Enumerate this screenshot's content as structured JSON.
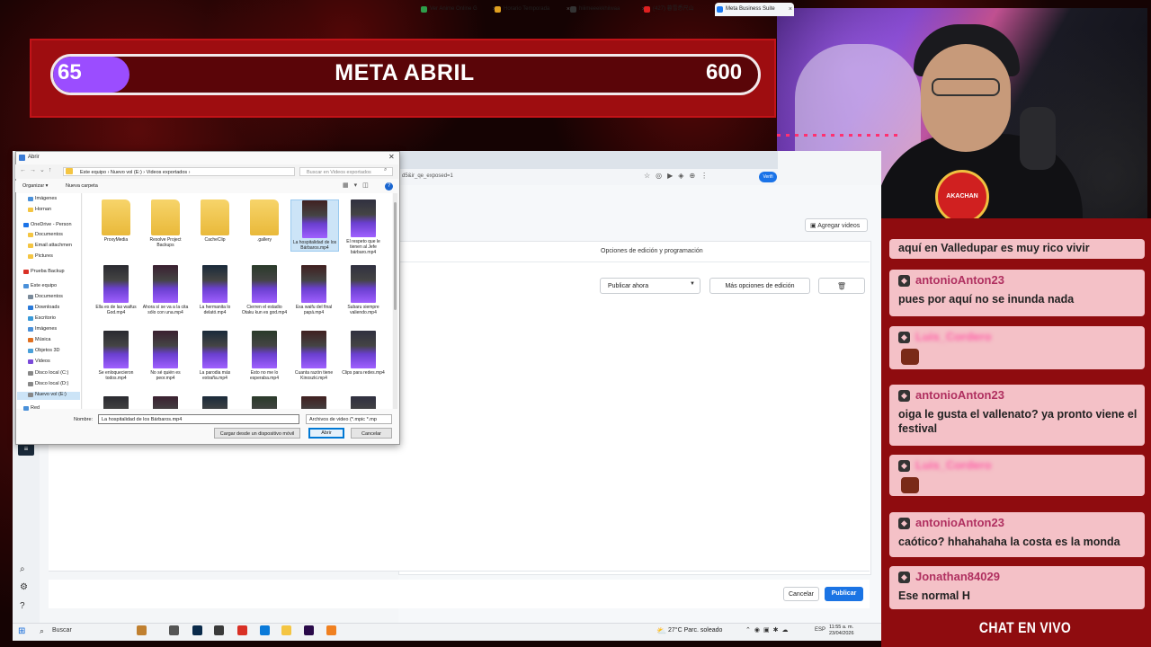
{
  "stream_goal": {
    "current": "65",
    "title": "META ABRIL",
    "target": "600",
    "progress_fraction": 0.108,
    "fill_color": "#9b4dff",
    "panel_color": "#9e0d10"
  },
  "webcam": {
    "badge_text": "AKACHAN"
  },
  "chat": {
    "label": "CHAT EN VIVO",
    "messages": [
      {
        "user": "",
        "text": "aquí en Valledupar es muy rico vivir",
        "emote": false
      },
      {
        "user": "antonioAnton23",
        "text": "pues por aquí no se inunda nada",
        "emote": false
      },
      {
        "user": "Luis_Cordero",
        "text": "",
        "emote": true
      },
      {
        "user": "antonioAnton23",
        "text": "oiga le gusta el vallenato? ya pronto viene el festival",
        "emote": false
      },
      {
        "user": "Luis_Cordero",
        "text": "",
        "emote": true
      },
      {
        "user": "antonioAnton23",
        "text": "caótico? hhahahaha la costa es la monda",
        "emote": false
      },
      {
        "user": "Jonathan84029",
        "text": "Ese normal H",
        "emote": false
      }
    ]
  },
  "browser": {
    "tabs": [
      {
        "label": "Ver Anime Online G",
        "color": "#2e9e4a"
      },
      {
        "label": "Horario Temporada",
        "color": "#e0a020"
      },
      {
        "label": "hiiimeeekkhiiwaa",
        "color": "#333"
      },
      {
        "label": "(427) 暮雪悉尺山",
        "color": "#e02020"
      },
      {
        "label": "Meta Business Suite",
        "color": "#1877f2"
      }
    ],
    "address_fragment": "d5&ir_qe_exposed=1",
    "verify_label": "Verifi"
  },
  "composer": {
    "add_videos": "Agregar videos",
    "edit_options_label": "Opciones de edición y programación",
    "publish_select": "Publicar ahora",
    "more_edit": "Más opciones de edición",
    "cancel": "Cancelar",
    "publish": "Publicar"
  },
  "file_dialog": {
    "title": "Abrir",
    "breadcrumb": "Este equipo  ›  Nuevo vol (E:)  ›  Videos exportados  ›",
    "search_placeholder": "Buscar en Videos exportados",
    "organize": "Organizar ▾",
    "new_folder": "Nueva carpeta",
    "nav_items": [
      {
        "label": "Imágenes",
        "indent": 1,
        "color": "#4a90d9"
      },
      {
        "label": "Hornan",
        "indent": 1,
        "color": "#f4c542"
      },
      {
        "label": "OneDrive - Person",
        "indent": 0,
        "color": "#1a73e8"
      },
      {
        "label": "Documentos",
        "indent": 1,
        "color": "#f4c542"
      },
      {
        "label": "Email attachmen",
        "indent": 1,
        "color": "#f4c542"
      },
      {
        "label": "Pictures",
        "indent": 1,
        "color": "#f4c542"
      },
      {
        "label": "Prueba Backup",
        "indent": 0,
        "color": "#d93025"
      },
      {
        "label": "Este equipo",
        "indent": 0,
        "color": "#4a90d9"
      },
      {
        "label": "Documentos",
        "indent": 1,
        "color": "#7a8a9a"
      },
      {
        "label": "Downloads",
        "indent": 1,
        "color": "#2a7ad9"
      },
      {
        "label": "Escritorio",
        "indent": 1,
        "color": "#3a9ad9"
      },
      {
        "label": "Imágenes",
        "indent": 1,
        "color": "#4a90d9"
      },
      {
        "label": "Música",
        "indent": 1,
        "color": "#e07020"
      },
      {
        "label": "Objetos 3D",
        "indent": 1,
        "color": "#4aa0d9"
      },
      {
        "label": "Videos",
        "indent": 1,
        "color": "#7a4ad9"
      },
      {
        "label": "Disco local (C:)",
        "indent": 1,
        "color": "#888"
      },
      {
        "label": "Disco local (D:)",
        "indent": 1,
        "color": "#888"
      },
      {
        "label": "Nuevo vol (E:)",
        "indent": 1,
        "color": "#888"
      },
      {
        "label": "Red",
        "indent": 0,
        "color": "#4a90d9"
      }
    ],
    "files": [
      {
        "label": "ProxyMedia",
        "kind": "folder"
      },
      {
        "label": "Resolve Project Backups",
        "kind": "folder"
      },
      {
        "label": "CacheClip",
        "kind": "folder"
      },
      {
        "label": ".gallery",
        "kind": "folder"
      },
      {
        "label": "La hospitalidad de los Bárbaros.mp4",
        "kind": "video",
        "selected": true
      },
      {
        "label": "El respeto que le tienen al Jefe bárbaro.mp4",
        "kind": "video"
      },
      {
        "label": "Ella es de las waifus God.mp4",
        "kind": "video"
      },
      {
        "label": "Ahora sí se va a la cita sólo con una.mp4",
        "kind": "video"
      },
      {
        "label": "La hermanita lo delató.mp4",
        "kind": "video"
      },
      {
        "label": "Cierren el estadio Otaku kun es god.mp4",
        "kind": "video"
      },
      {
        "label": "Esa waifu del final papá.mp4",
        "kind": "video"
      },
      {
        "label": "Subaru siempre valiendo.mp4",
        "kind": "video"
      },
      {
        "label": "Se enloquecieron todos.mp4",
        "kind": "video"
      },
      {
        "label": "No sé quién es peor.mp4",
        "kind": "video"
      },
      {
        "label": "La parodia más extraña.mp4",
        "kind": "video"
      },
      {
        "label": "Esto no me lo esperaba.mp4",
        "kind": "video"
      },
      {
        "label": "Cuanta razón tiene Kinoszki.mp4",
        "kind": "video"
      },
      {
        "label": "Clips para redes.mp4",
        "kind": "video"
      },
      {
        "label": "",
        "kind": "video"
      },
      {
        "label": "",
        "kind": "video"
      },
      {
        "label": "",
        "kind": "video"
      },
      {
        "label": "",
        "kind": "video"
      },
      {
        "label": "",
        "kind": "video"
      },
      {
        "label": "",
        "kind": "video"
      }
    ],
    "filename_label": "Nombre:",
    "filename_value": "La hospitalidad de los Bárbaros.mp4",
    "filetype": "Archivos de video (*.mpic *.mp",
    "upload_mobile": "Cargar desde un dispositivo móvil",
    "open": "Abrir",
    "cancel": "Cancelar"
  },
  "taskbar": {
    "search": "Buscar",
    "weather": "27°C  Parc. soleado",
    "lang": "ESP",
    "time": "11:55 a. m.",
    "date": "23/04/2026",
    "apps": [
      {
        "name": "copilot-icon",
        "color": "#c08030"
      },
      {
        "name": "task-view-icon",
        "color": "#555"
      },
      {
        "name": "photoshop-icon",
        "color": "#0a2a4a"
      },
      {
        "name": "stream-app-icon",
        "color": "#3a3a3a"
      },
      {
        "name": "chrome-icon",
        "color": "#d93025"
      },
      {
        "name": "edge-icon",
        "color": "#0a7ad9"
      },
      {
        "name": "explorer-icon",
        "color": "#f4c542"
      },
      {
        "name": "premiere-icon",
        "color": "#2a0a4a"
      },
      {
        "name": "vlc-icon",
        "color": "#f08020"
      }
    ]
  }
}
